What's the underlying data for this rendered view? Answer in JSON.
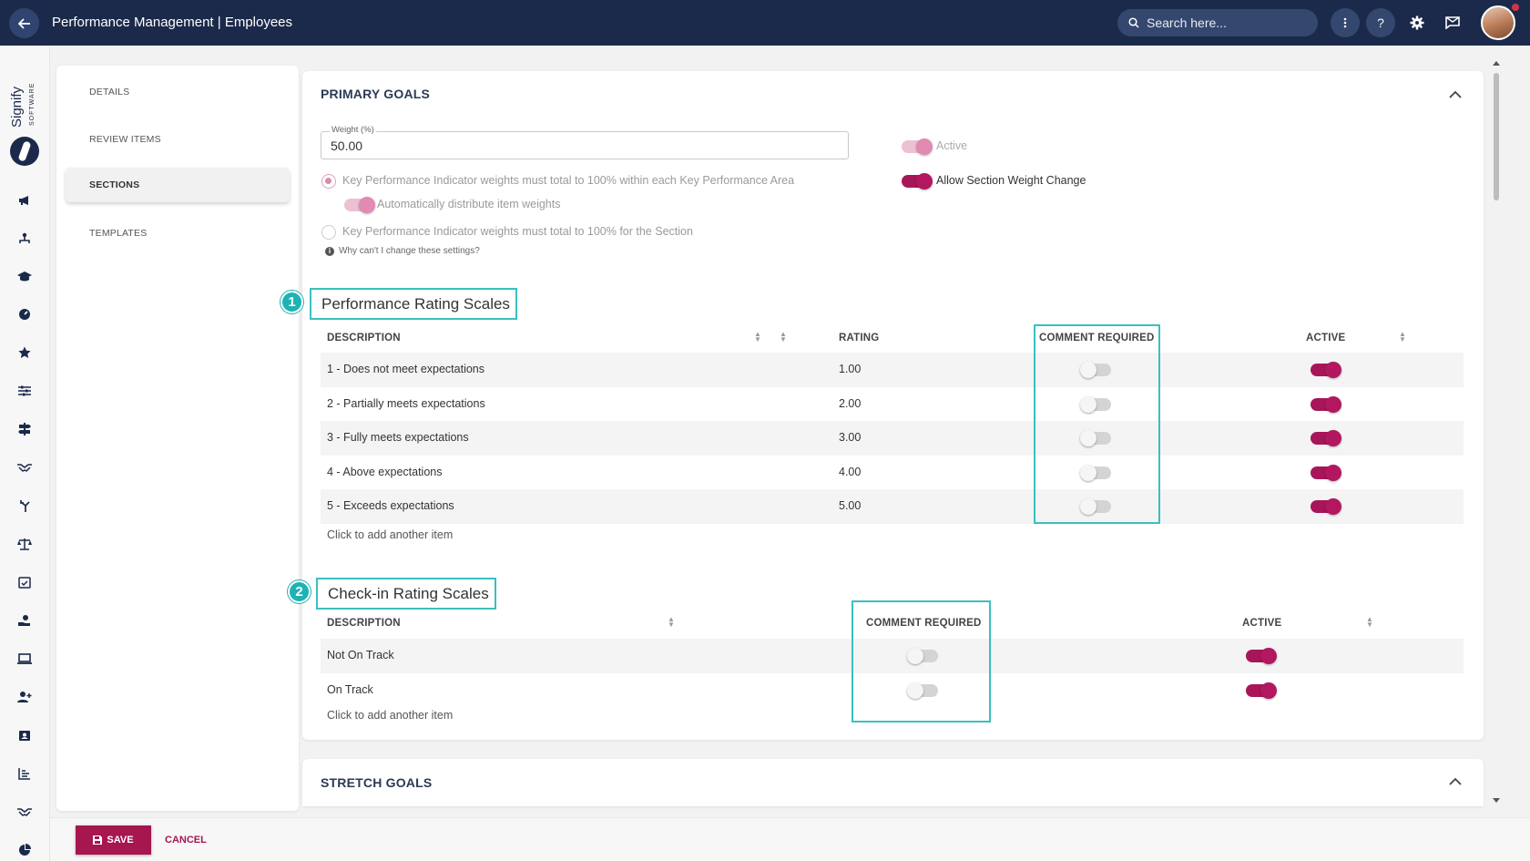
{
  "header": {
    "title": "Performance Management | Employees",
    "search_placeholder": "Search here..."
  },
  "brand": {
    "name": "Signify",
    "sub": "SOFTWARE"
  },
  "subnav": {
    "items": [
      {
        "label": "DETAILS"
      },
      {
        "label": "REVIEW ITEMS"
      },
      {
        "label": "SECTIONS",
        "active": true
      },
      {
        "label": "TEMPLATES"
      }
    ]
  },
  "primary_goals": {
    "title": "PRIMARY GOALS",
    "weight_label": "Weight (%)",
    "weight_value": "50.00",
    "active_label": "Active",
    "active_on": true,
    "allow_weight_change_label": "Allow Section Weight Change",
    "allow_weight_change_on": true,
    "radio_kpa": "Key Performance Indicator weights must total to 100% within each Key Performance Area",
    "auto_distribute_label": "Automatically distribute item weights",
    "radio_section": "Key Performance Indicator weights must total to 100% for the Section",
    "info_text": "Why can't I change these settings?"
  },
  "performance_scales": {
    "badge": "1",
    "title": "Performance Rating Scales",
    "headers": {
      "description": "DESCRIPTION",
      "rating": "RATING",
      "comment_required": "COMMENT REQUIRED",
      "active": "ACTIVE"
    },
    "rows": [
      {
        "description": "1 - Does not meet expectations",
        "rating": "1.00",
        "comment_required": false,
        "active": true
      },
      {
        "description": "2 - Partially meets expectations",
        "rating": "2.00",
        "comment_required": false,
        "active": true
      },
      {
        "description": "3 - Fully meets expectations",
        "rating": "3.00",
        "comment_required": false,
        "active": true
      },
      {
        "description": "4 - Above expectations",
        "rating": "4.00",
        "comment_required": false,
        "active": true
      },
      {
        "description": "5 - Exceeds expectations",
        "rating": "5.00",
        "comment_required": false,
        "active": true
      }
    ],
    "add_label": "Click to add another item"
  },
  "checkin_scales": {
    "badge": "2",
    "title": "Check-in Rating Scales",
    "headers": {
      "description": "DESCRIPTION",
      "comment_required": "COMMENT REQUIRED",
      "active": "ACTIVE"
    },
    "rows": [
      {
        "description": "Not On Track",
        "comment_required": false,
        "active": true
      },
      {
        "description": "On Track",
        "comment_required": false,
        "active": true
      }
    ],
    "add_label": "Click to add another item"
  },
  "stretch_goals": {
    "title": "STRETCH GOALS"
  },
  "footer": {
    "save_label": "SAVE",
    "cancel_label": "CANCEL"
  },
  "colors": {
    "topbar": "#1b2a4a",
    "accent": "#a6164f",
    "highlight": "#3bbfbf"
  }
}
